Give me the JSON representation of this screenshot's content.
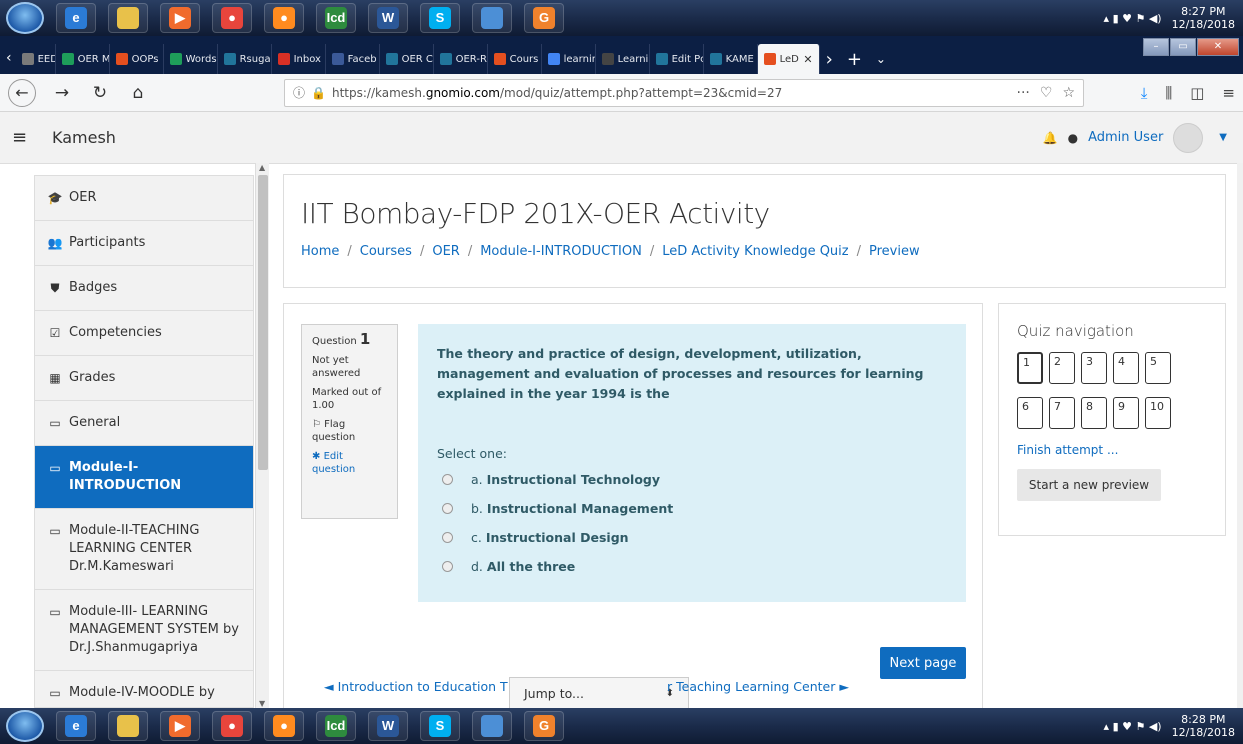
{
  "taskbar_top": {
    "apps": [
      {
        "name": "ie-icon",
        "color": "#2b7bd6",
        "glyph": "e"
      },
      {
        "name": "file-explorer-icon",
        "color": "#e8c14a",
        "glyph": ""
      },
      {
        "name": "media-player-icon",
        "color": "#f06b2d",
        "glyph": "▶"
      },
      {
        "name": "chrome-icon",
        "color": "#e8453c",
        "glyph": "●"
      },
      {
        "name": "firefox-icon",
        "color": "#ff8b1f",
        "glyph": "●"
      },
      {
        "name": "icecream-recorder-icon",
        "color": "#2e8b3e",
        "glyph": "Icd"
      },
      {
        "name": "word-icon",
        "color": "#2b5797",
        "glyph": "W"
      },
      {
        "name": "skype-icon",
        "color": "#00aff0",
        "glyph": "S"
      },
      {
        "name": "photos-icon",
        "color": "#4c8fd6",
        "glyph": ""
      },
      {
        "name": "pdf-icon",
        "color": "#f0822c",
        "glyph": "G"
      }
    ],
    "time": "8:27 PM",
    "date": "12/18/2018"
  },
  "taskbar_bottom": {
    "time": "8:28 PM",
    "date": "12/18/2018"
  },
  "tabs": [
    {
      "label": "EEDB",
      "color": "#7a7a7a"
    },
    {
      "label": "OER M",
      "color": "#1e9e5a"
    },
    {
      "label": "OOPs",
      "color": "#e54f1f"
    },
    {
      "label": "Words",
      "color": "#1e9e5a"
    },
    {
      "label": "Rsuga",
      "color": "#21759b"
    },
    {
      "label": "Inbox",
      "color": "#d93025"
    },
    {
      "label": "Faceb",
      "color": "#3b5998"
    },
    {
      "label": "OER C",
      "color": "#21759b"
    },
    {
      "label": "OER-R",
      "color": "#21759b"
    },
    {
      "label": "Cours",
      "color": "#e54f1f"
    },
    {
      "label": "learnin",
      "color": "#4285f4"
    },
    {
      "label": "Learni",
      "color": "#444444"
    },
    {
      "label": "Edit Pc",
      "color": "#21759b"
    },
    {
      "label": "KAME",
      "color": "#21759b"
    },
    {
      "label": "LeD",
      "color": "#e54f1f"
    }
  ],
  "browser": {
    "url_prefix": "https://kamesh.",
    "url_domain": "gnomio.com",
    "url_path": "/mod/quiz/attempt.php?attempt=23&cmid=27",
    "url_more": "···"
  },
  "header": {
    "site_name": "Kamesh",
    "user_name": "Admin User"
  },
  "sidebar": {
    "items": [
      {
        "label": "OER",
        "icon": "graduation-cap-icon",
        "glyph": "🎓"
      },
      {
        "label": "Participants",
        "icon": "users-icon",
        "glyph": "👥"
      },
      {
        "label": "Badges",
        "icon": "shield-icon",
        "glyph": "⛊"
      },
      {
        "label": "Competencies",
        "icon": "checkbox-icon",
        "glyph": "☑"
      },
      {
        "label": "Grades",
        "icon": "table-icon",
        "glyph": "▦"
      },
      {
        "label": "General",
        "icon": "folder-icon",
        "glyph": "▭"
      },
      {
        "label": "Module-I-INTRODUCTION",
        "icon": "folder-icon",
        "glyph": "▭"
      },
      {
        "label": "Module-II-TEACHING LEARNING CENTER Dr.M.Kameswari",
        "icon": "folder-icon",
        "glyph": "▭"
      },
      {
        "label": "Module-III- LEARNING MANAGEMENT SYSTEM by Dr.J.Shanmugapriya",
        "icon": "folder-icon",
        "glyph": "▭"
      },
      {
        "label": "Module-IV-MOODLE by",
        "icon": "folder-icon",
        "glyph": "▭"
      }
    ],
    "active_index": 6,
    "active_color": "#0f6cbf"
  },
  "page": {
    "title": "IIT Bombay-FDP 201X-OER Activity",
    "breadcrumb": [
      "Home",
      "Courses",
      "OER",
      "Module-I-INTRODUCTION",
      "LeD Activity Knowledge Quiz",
      "Preview"
    ]
  },
  "question": {
    "label": "Question",
    "number": "1",
    "status": "Not yet answered",
    "marked": "Marked out of 1.00",
    "flag": "Flag question",
    "edit": "Edit question",
    "text": "The theory and practice of design, development, utilization, management and evaluation of processes and resources for learning explained in the year 1994 is the",
    "select_label": "Select one:",
    "options": [
      {
        "prefix": "a.",
        "text": "Instructional Technology"
      },
      {
        "prefix": "b.",
        "text": "Instructional Management"
      },
      {
        "prefix": "c.",
        "text": "Instructional Design"
      },
      {
        "prefix": "d.",
        "text": "All the three"
      }
    ],
    "next_label": "Next page"
  },
  "activity_nav": {
    "prev": "◄ Introduction to Education T",
    "jump_label": "Jump to...",
    "next": "r Teaching Learning Center ►"
  },
  "quiz_nav": {
    "title": "Quiz navigation",
    "buttons": [
      "1",
      "2",
      "3",
      "4",
      "5",
      "6",
      "7",
      "8",
      "9",
      "10"
    ],
    "finish": "Finish attempt ...",
    "new_preview": "Start a new preview"
  }
}
